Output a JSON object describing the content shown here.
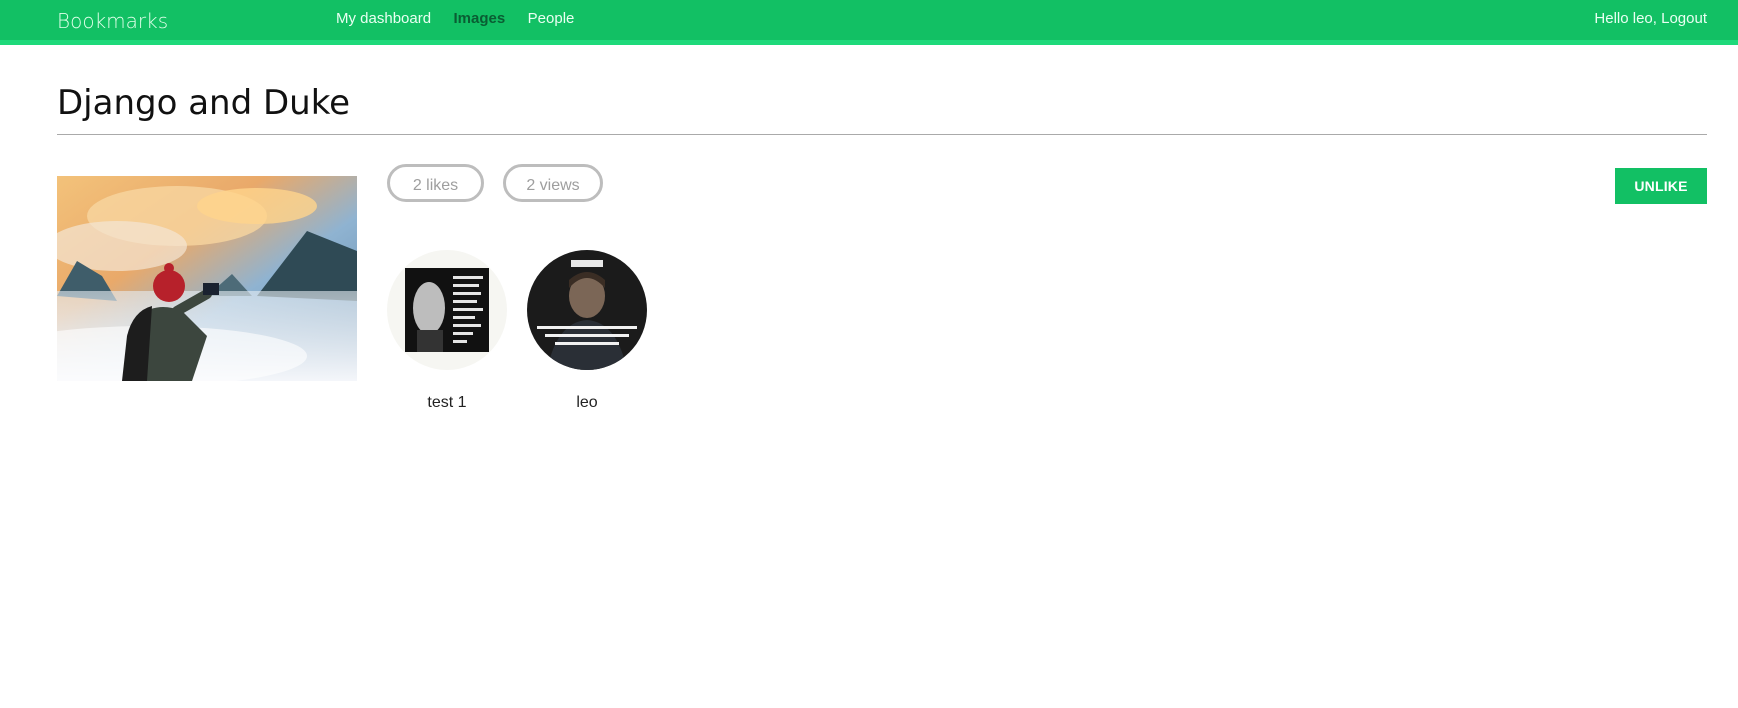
{
  "header": {
    "logo": "Bookmarks",
    "nav": [
      {
        "label": "My dashboard",
        "selected": false
      },
      {
        "label": "Images",
        "selected": true
      },
      {
        "label": "People",
        "selected": false
      }
    ],
    "greeting": "Hello leo,",
    "logout": "Logout"
  },
  "image": {
    "title": "Django and Duke",
    "total_likes": "2 likes",
    "total_views": "2 views",
    "like_button": "UNLIKE"
  },
  "likers": [
    {
      "name": "test 1",
      "avatar_text": "The people who are crazy enough to think that they can change the world, are the ones who do."
    },
    {
      "name": "leo",
      "avatar_badge": "INCEPTION",
      "avatar_text": "Once an idea has taken hold of the brain it's almost impossible to eradicate"
    }
  ],
  "colors": {
    "brand": "#12c064",
    "brand_border": "#1ed97a",
    "nav_selected": "#0a5d33"
  }
}
